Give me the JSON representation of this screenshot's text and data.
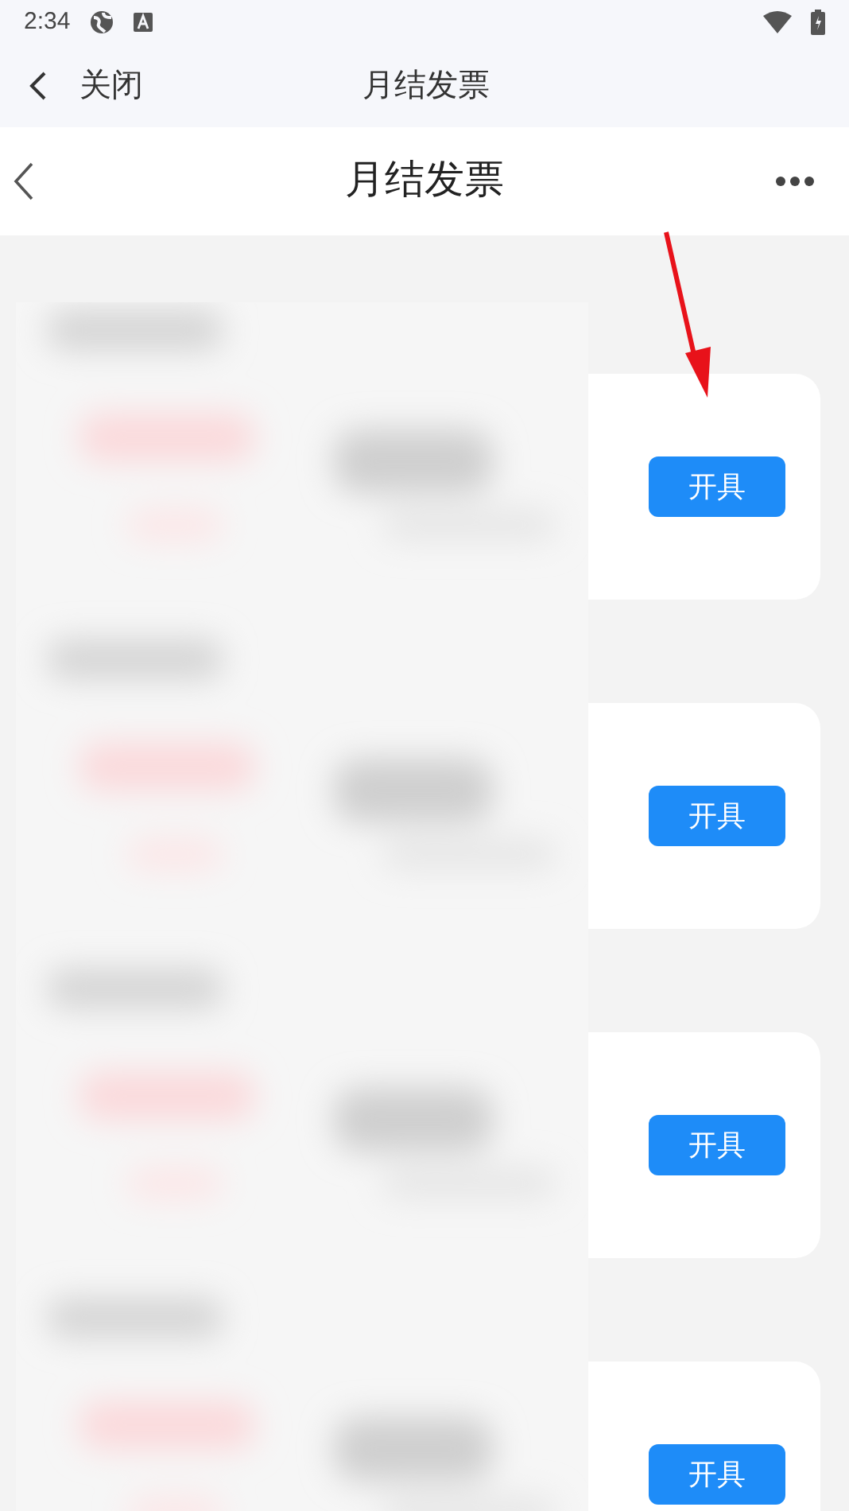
{
  "status_bar": {
    "time": "2:34"
  },
  "webview_bar": {
    "close_label": "关闭",
    "title": "月结发票"
  },
  "header": {
    "title": "月结发票"
  },
  "invoices": [
    {
      "button": "开具"
    },
    {
      "button": "开具"
    },
    {
      "button": "开具"
    },
    {
      "button": "开具"
    }
  ]
}
